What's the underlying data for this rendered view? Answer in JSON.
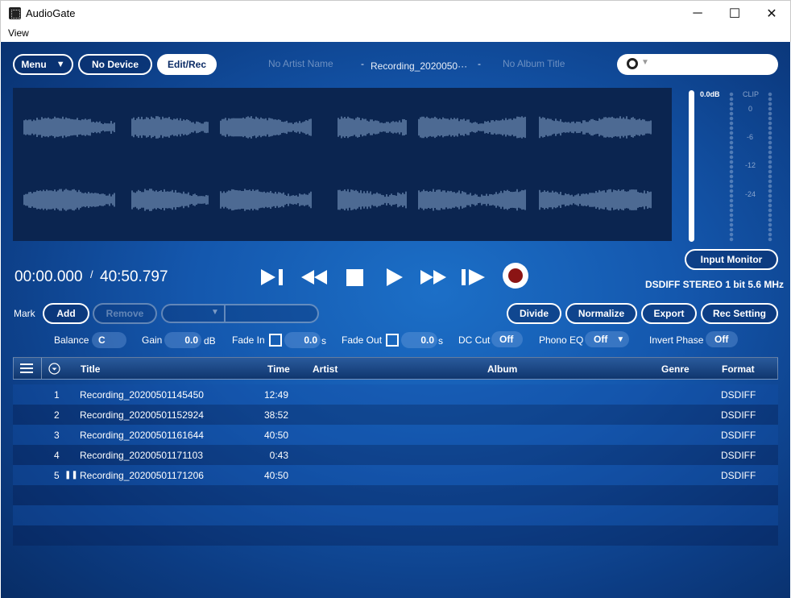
{
  "window": {
    "title": "AudioGate",
    "minimize": "─",
    "maximize": "☐",
    "close": "✕"
  },
  "menubar": {
    "view": "View"
  },
  "toolbar": {
    "menu_label": "Menu",
    "menu_arrow": "▼",
    "device_label": "No Device",
    "editrec_label": "Edit/Rec"
  },
  "now_playing": {
    "artist": "No Artist Name",
    "sep1": "-",
    "title": "Recording_2020050···",
    "sep2": "-",
    "album": "No Album Title"
  },
  "search": {
    "placeholder": "",
    "icon": "search-icon",
    "caret": "▼"
  },
  "meter": {
    "peak_label": "0.0dB",
    "clip_label": "CLIP",
    "scale": [
      "0",
      "-6",
      "-12",
      "-24"
    ]
  },
  "transport": {
    "current_time": "00:00.000",
    "separator": "/",
    "total_time": "40:50.797",
    "input_monitor_label": "Input Monitor",
    "format_info": "DSDIFF STEREO 1 bit 5.6 MHz"
  },
  "mark": {
    "label": "Mark",
    "add_label": "Add",
    "remove_label": "Remove",
    "arrow": "▼"
  },
  "actions": {
    "divide_label": "Divide",
    "normalize_label": "Normalize",
    "export_label": "Export",
    "rec_setting_label": "Rec Setting"
  },
  "params": {
    "balance_label": "Balance",
    "balance_value": "C",
    "gain_label": "Gain",
    "gain_value": "0.0",
    "gain_unit": "dB",
    "fade_in_label": "Fade In",
    "fade_in_value": "0.0",
    "fade_in_unit": "s",
    "fade_out_label": "Fade Out",
    "fade_out_value": "0.0",
    "fade_out_unit": "s",
    "dc_cut_label": "DC Cut",
    "dc_cut_value": "Off",
    "phono_eq_label": "Phono EQ",
    "phono_eq_value": "Off",
    "phono_eq_arrow": "▼",
    "invert_phase_label": "Invert Phase",
    "invert_phase_value": "Off"
  },
  "table": {
    "columns": [
      "Title",
      "Time",
      "Artist",
      "Album",
      "Genre",
      "Format"
    ],
    "rows": [
      {
        "num": "1",
        "title": "Recording_20200501145450",
        "time": "12:49",
        "artist": "",
        "album": "",
        "genre": "",
        "format": "DSDIFF",
        "playing": false
      },
      {
        "num": "2",
        "title": "Recording_20200501152924",
        "time": "38:52",
        "artist": "",
        "album": "",
        "genre": "",
        "format": "DSDIFF",
        "playing": false
      },
      {
        "num": "3",
        "title": "Recording_20200501161644",
        "time": "40:50",
        "artist": "",
        "album": "",
        "genre": "",
        "format": "DSDIFF",
        "playing": false
      },
      {
        "num": "4",
        "title": "Recording_20200501171103",
        "time": "0:43",
        "artist": "",
        "album": "",
        "genre": "",
        "format": "DSDIFF",
        "playing": false
      },
      {
        "num": "5",
        "title": "Recording_20200501171206",
        "time": "40:50",
        "artist": "",
        "album": "",
        "genre": "",
        "format": "DSDIFF",
        "playing": true
      }
    ],
    "pause_glyph": "❚❚"
  },
  "colors": {
    "accent": "#1457ad",
    "record": "#8b1414",
    "waveform": "#4d6a93"
  }
}
